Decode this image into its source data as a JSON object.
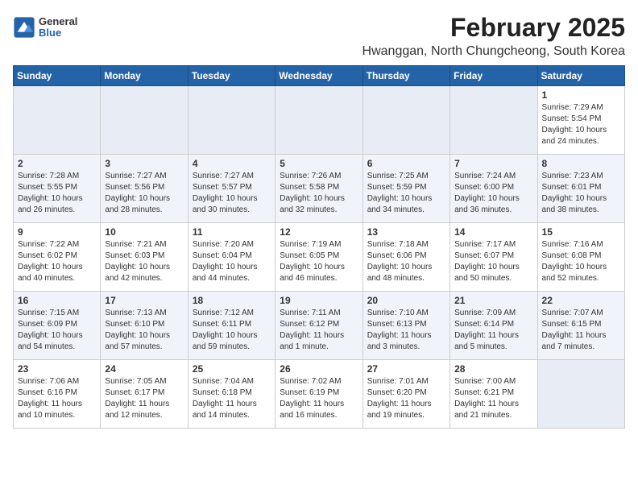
{
  "logo": {
    "general": "General",
    "blue": "Blue"
  },
  "header": {
    "title": "February 2025",
    "subtitle": "Hwanggan, North Chungcheong, South Korea"
  },
  "days_of_week": [
    "Sunday",
    "Monday",
    "Tuesday",
    "Wednesday",
    "Thursday",
    "Friday",
    "Saturday"
  ],
  "weeks": [
    [
      {
        "day": "",
        "info": ""
      },
      {
        "day": "",
        "info": ""
      },
      {
        "day": "",
        "info": ""
      },
      {
        "day": "",
        "info": ""
      },
      {
        "day": "",
        "info": ""
      },
      {
        "day": "",
        "info": ""
      },
      {
        "day": "1",
        "info": "Sunrise: 7:29 AM\nSunset: 5:54 PM\nDaylight: 10 hours and 24 minutes."
      }
    ],
    [
      {
        "day": "2",
        "info": "Sunrise: 7:28 AM\nSunset: 5:55 PM\nDaylight: 10 hours and 26 minutes."
      },
      {
        "day": "3",
        "info": "Sunrise: 7:27 AM\nSunset: 5:56 PM\nDaylight: 10 hours and 28 minutes."
      },
      {
        "day": "4",
        "info": "Sunrise: 7:27 AM\nSunset: 5:57 PM\nDaylight: 10 hours and 30 minutes."
      },
      {
        "day": "5",
        "info": "Sunrise: 7:26 AM\nSunset: 5:58 PM\nDaylight: 10 hours and 32 minutes."
      },
      {
        "day": "6",
        "info": "Sunrise: 7:25 AM\nSunset: 5:59 PM\nDaylight: 10 hours and 34 minutes."
      },
      {
        "day": "7",
        "info": "Sunrise: 7:24 AM\nSunset: 6:00 PM\nDaylight: 10 hours and 36 minutes."
      },
      {
        "day": "8",
        "info": "Sunrise: 7:23 AM\nSunset: 6:01 PM\nDaylight: 10 hours and 38 minutes."
      }
    ],
    [
      {
        "day": "9",
        "info": "Sunrise: 7:22 AM\nSunset: 6:02 PM\nDaylight: 10 hours and 40 minutes."
      },
      {
        "day": "10",
        "info": "Sunrise: 7:21 AM\nSunset: 6:03 PM\nDaylight: 10 hours and 42 minutes."
      },
      {
        "day": "11",
        "info": "Sunrise: 7:20 AM\nSunset: 6:04 PM\nDaylight: 10 hours and 44 minutes."
      },
      {
        "day": "12",
        "info": "Sunrise: 7:19 AM\nSunset: 6:05 PM\nDaylight: 10 hours and 46 minutes."
      },
      {
        "day": "13",
        "info": "Sunrise: 7:18 AM\nSunset: 6:06 PM\nDaylight: 10 hours and 48 minutes."
      },
      {
        "day": "14",
        "info": "Sunrise: 7:17 AM\nSunset: 6:07 PM\nDaylight: 10 hours and 50 minutes."
      },
      {
        "day": "15",
        "info": "Sunrise: 7:16 AM\nSunset: 6:08 PM\nDaylight: 10 hours and 52 minutes."
      }
    ],
    [
      {
        "day": "16",
        "info": "Sunrise: 7:15 AM\nSunset: 6:09 PM\nDaylight: 10 hours and 54 minutes."
      },
      {
        "day": "17",
        "info": "Sunrise: 7:13 AM\nSunset: 6:10 PM\nDaylight: 10 hours and 57 minutes."
      },
      {
        "day": "18",
        "info": "Sunrise: 7:12 AM\nSunset: 6:11 PM\nDaylight: 10 hours and 59 minutes."
      },
      {
        "day": "19",
        "info": "Sunrise: 7:11 AM\nSunset: 6:12 PM\nDaylight: 11 hours and 1 minute."
      },
      {
        "day": "20",
        "info": "Sunrise: 7:10 AM\nSunset: 6:13 PM\nDaylight: 11 hours and 3 minutes."
      },
      {
        "day": "21",
        "info": "Sunrise: 7:09 AM\nSunset: 6:14 PM\nDaylight: 11 hours and 5 minutes."
      },
      {
        "day": "22",
        "info": "Sunrise: 7:07 AM\nSunset: 6:15 PM\nDaylight: 11 hours and 7 minutes."
      }
    ],
    [
      {
        "day": "23",
        "info": "Sunrise: 7:06 AM\nSunset: 6:16 PM\nDaylight: 11 hours and 10 minutes."
      },
      {
        "day": "24",
        "info": "Sunrise: 7:05 AM\nSunset: 6:17 PM\nDaylight: 11 hours and 12 minutes."
      },
      {
        "day": "25",
        "info": "Sunrise: 7:04 AM\nSunset: 6:18 PM\nDaylight: 11 hours and 14 minutes."
      },
      {
        "day": "26",
        "info": "Sunrise: 7:02 AM\nSunset: 6:19 PM\nDaylight: 11 hours and 16 minutes."
      },
      {
        "day": "27",
        "info": "Sunrise: 7:01 AM\nSunset: 6:20 PM\nDaylight: 11 hours and 19 minutes."
      },
      {
        "day": "28",
        "info": "Sunrise: 7:00 AM\nSunset: 6:21 PM\nDaylight: 11 hours and 21 minutes."
      },
      {
        "day": "",
        "info": ""
      }
    ]
  ]
}
